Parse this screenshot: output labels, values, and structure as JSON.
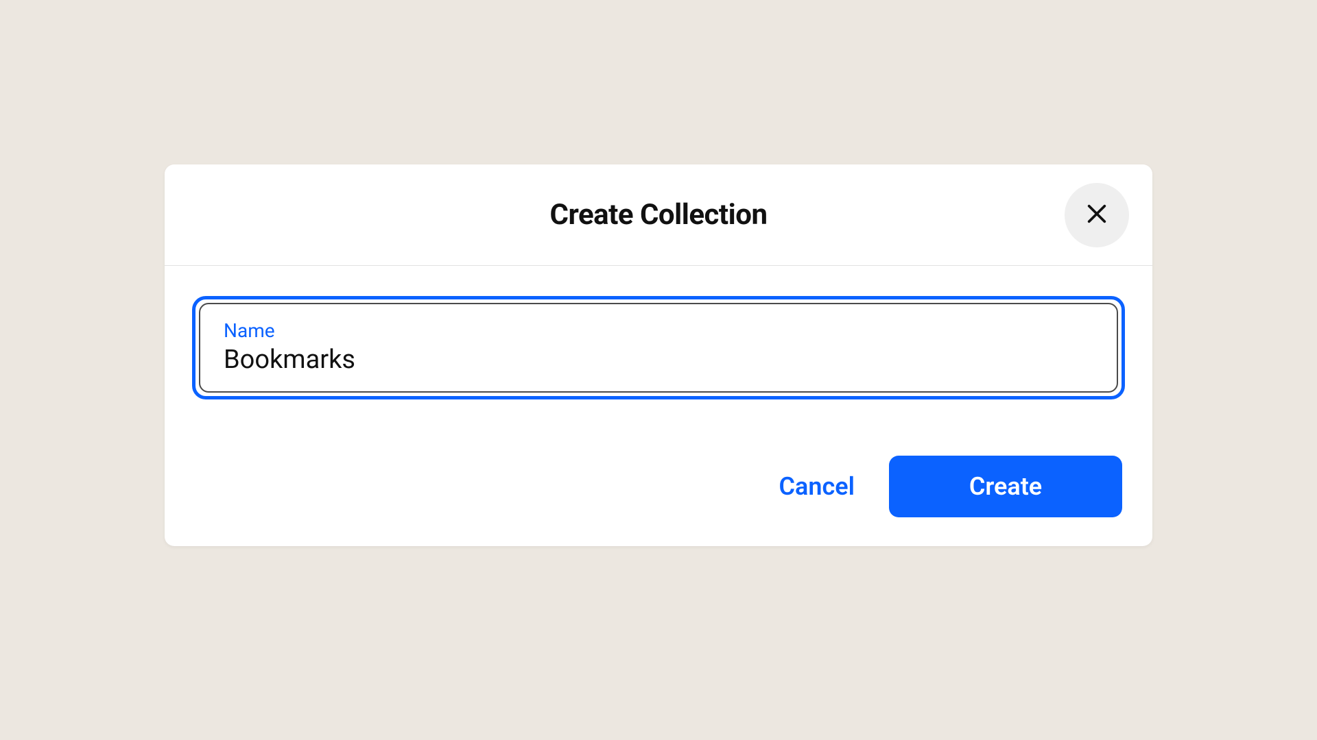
{
  "dialog": {
    "title": "Create Collection",
    "field": {
      "label": "Name",
      "value": "Bookmarks"
    },
    "buttons": {
      "cancel": "Cancel",
      "create": "Create"
    }
  },
  "colors": {
    "accent": "#0b62ff",
    "background": "#ece7e0",
    "surface": "#ffffff",
    "closeBg": "#efefef"
  }
}
